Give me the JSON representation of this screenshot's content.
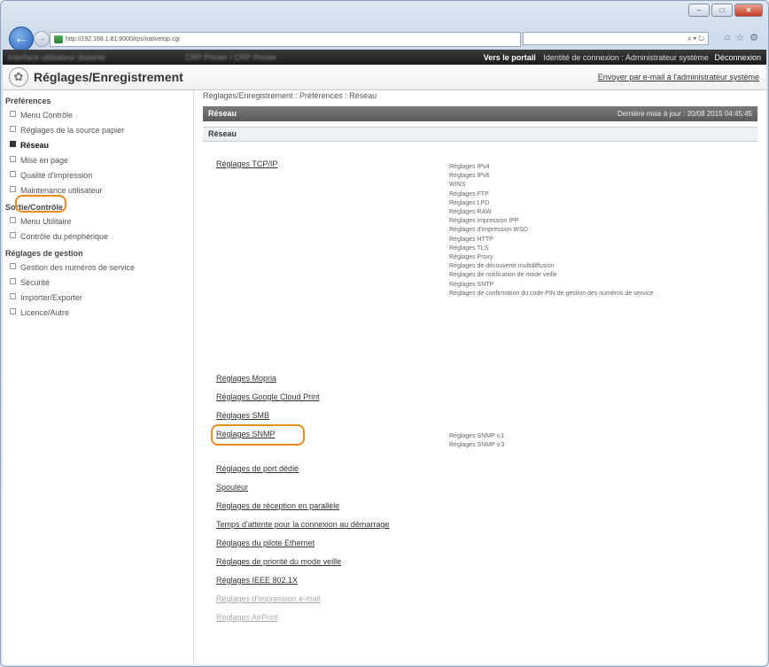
{
  "browser": {
    "url": "http://192.168.1.81:8000/rps/nativetop.cgi",
    "url_host": "192.168.1.81:8000",
    "search_text": "⌕ ▾ ↻",
    "window_controls": [
      "–",
      "□",
      "✕"
    ],
    "top_icons": [
      "⌂",
      "☆",
      "⚙"
    ]
  },
  "topbar": {
    "blurred_left": "Interface utilisateur distante",
    "blurred_mid": "CRP Printer / CRP Printer",
    "portal_link": "Vers le portail",
    "login_label": "Identité de connexion : Administrateur système",
    "logout": "Déconnexion"
  },
  "header": {
    "title": "Réglages/Enregistrement",
    "mail_link": "Envoyer par e-mail à l'administrateur système"
  },
  "sidebar": {
    "groups": [
      {
        "label": "Préférences",
        "items": [
          "Menu Contrôle",
          "Réglages de la source papier",
          "Réseau",
          "Mise en page",
          "Qualité d'impression",
          "Maintenance utilisateur"
        ]
      },
      {
        "label": "Sortie/Contrôle",
        "items": [
          "Menu Utilitaire",
          "Contrôle du périphérique"
        ]
      },
      {
        "label": "Réglages de gestion",
        "items": [
          "Gestion des numéros de service",
          "Sécurité",
          "Importer/Exporter",
          "Licence/Autre"
        ]
      }
    ],
    "selected": "Réseau"
  },
  "main": {
    "breadcrumb": "Réglages/Enregistrement : Préférences : Réseau",
    "section_title": "Réseau",
    "last_update": "Dernière mise à jour : 20/08 2015 04:45:45",
    "subsection_title": "Réseau",
    "tcpip": {
      "label": "Réglages TCP/IP",
      "items": [
        "Réglages IPv4",
        "Réglages IPv6",
        "WINS",
        "Réglages FTP",
        "Réglages LPD",
        "Réglages RAW",
        "Réglages impression IPP",
        "Réglages d'impression WSD",
        "Réglages HTTP",
        "Réglages TLS",
        "Réglages Proxy",
        "Réglages de découverte multidiffusion",
        "Réglages de notification de mode veille",
        "Réglages SNTP",
        "Réglages de confirmation du code PIN de gestion des numéros de service"
      ]
    },
    "links_a": [
      "Réglages Mopria",
      "Réglages Google Cloud Print",
      "Réglages SMB"
    ],
    "snmp": {
      "label": "Réglages SNMP",
      "items": [
        "Réglages SNMP v.1",
        "Réglages SNMP v.3"
      ]
    },
    "links_b": [
      "Réglages de port dédié",
      "Spouleur",
      "Réglages de réception en parallèle",
      "Temps d'attente pour la connexion au démarrage",
      "Réglages du pilote Ethernet",
      "Réglages de priorité du mode veille",
      "Réglages IEEE 802.1X"
    ],
    "links_dim": [
      "Réglages d'impression e-mail",
      "Réglages AirPrint"
    ]
  },
  "colors": {
    "highlight": "#ee8c1e",
    "section_bar": "#5a5a5a"
  }
}
